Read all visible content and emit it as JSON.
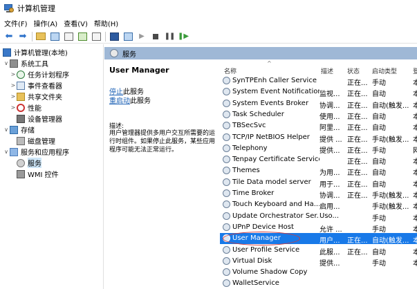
{
  "window": {
    "title": "计算机管理"
  },
  "menu": [
    "文件(F)",
    "操作(A)",
    "查看(V)",
    "帮助(H)"
  ],
  "tree": [
    {
      "label": "计算机管理(本地)",
      "chevron": "",
      "icon": "computer-icon"
    },
    {
      "label": "系统工具",
      "chevron": "∨",
      "icon": "tools-icon"
    },
    {
      "label": "任务计划程序",
      "chevron": ">",
      "icon": "clock-icon"
    },
    {
      "label": "事件查看器",
      "chevron": ">",
      "icon": "event-viewer-icon"
    },
    {
      "label": "共享文件夹",
      "chevron": ">",
      "icon": "shared-folder-icon"
    },
    {
      "label": "性能",
      "chevron": ">",
      "icon": "performance-icon"
    },
    {
      "label": "设备管理器",
      "chevron": "",
      "icon": "device-manager-icon"
    },
    {
      "label": "存储",
      "chevron": "∨",
      "icon": "storage-icon"
    },
    {
      "label": "磁盘管理",
      "chevron": "",
      "icon": "disk-icon"
    },
    {
      "label": "服务和应用程序",
      "chevron": "∨",
      "icon": "apps-icon"
    },
    {
      "label": "服务",
      "chevron": "",
      "icon": "services-icon",
      "selected": true
    },
    {
      "label": "WMI 控件",
      "chevron": "",
      "icon": "wmi-icon"
    }
  ],
  "services_header": "服务",
  "description_pane": {
    "title": "User Manager",
    "stop_link": "停止",
    "stop_suffix": "此服务",
    "restart_link": "重启动",
    "restart_suffix": "此服务",
    "desc_label": "描述:",
    "desc_text": "用户管理器提供多用户交互所需要的运行时组件。如果停止此服务，某些应用程序可能无法正常运行。"
  },
  "columns": [
    "名称",
    "描述",
    "状态",
    "启动类型",
    "登"
  ],
  "sort_indicator": "^",
  "services": [
    {
      "name": "SynTPEnh Caller Service",
      "desc": "",
      "status": "正在...",
      "start": "手动",
      "extra": "本"
    },
    {
      "name": "System Event Notification...",
      "desc": "监视...",
      "status": "正在...",
      "start": "自动",
      "extra": "本"
    },
    {
      "name": "System Events Broker",
      "desc": "协调...",
      "status": "正在...",
      "start": "自动(触发...",
      "extra": "本"
    },
    {
      "name": "Task Scheduler",
      "desc": "使用...",
      "status": "正在...",
      "start": "自动",
      "extra": "本"
    },
    {
      "name": "TBSecSvc",
      "desc": "阿里...",
      "status": "正在...",
      "start": "自动",
      "extra": "本"
    },
    {
      "name": "TCP/IP NetBIOS Helper",
      "desc": "提供 ...",
      "status": "正在...",
      "start": "手动(触发...",
      "extra": "本"
    },
    {
      "name": "Telephony",
      "desc": "提供...",
      "status": "正在...",
      "start": "手动",
      "extra": "网"
    },
    {
      "name": "Tenpay Certificate Service",
      "desc": "",
      "status": "正在...",
      "start": "自动",
      "extra": "本"
    },
    {
      "name": "Themes",
      "desc": "为用...",
      "status": "正在...",
      "start": "自动",
      "extra": "本"
    },
    {
      "name": "Tile Data model server",
      "desc": "用于...",
      "status": "正在...",
      "start": "自动",
      "extra": "本"
    },
    {
      "name": "Time Broker",
      "desc": "协调...",
      "status": "正在...",
      "start": "手动(触发...",
      "extra": "本"
    },
    {
      "name": "Touch Keyboard and Ha...",
      "desc": "启用...",
      "status": "",
      "start": "手动(触发...",
      "extra": "本"
    },
    {
      "name": "Update Orchestrator Ser...",
      "desc": "Uso...",
      "status": "",
      "start": "手动",
      "extra": "本"
    },
    {
      "name": "UPnP Device Host",
      "desc": "允许 ...",
      "status": "",
      "start": "手动",
      "extra": "本"
    },
    {
      "name": "User Manager",
      "desc": "用户...",
      "status": "正在...",
      "start": "自动(触发...",
      "extra": "本",
      "selected": true
    },
    {
      "name": "User Profile Service",
      "desc": "此服...",
      "status": "正在...",
      "start": "自动",
      "extra": "本"
    },
    {
      "name": "Virtual Disk",
      "desc": "提供...",
      "status": "",
      "start": "手动",
      "extra": "本"
    },
    {
      "name": "Volume Shadow Copy",
      "desc": "",
      "status": "",
      "start": "",
      "extra": ""
    },
    {
      "name": "WalletService",
      "desc": "",
      "status": "",
      "start": "",
      "extra": ""
    }
  ],
  "colors": {
    "selection": "#1879e8",
    "header_band": "#9fb8d6",
    "link": "#1a5fb4",
    "annotation": "#d23a3a"
  }
}
